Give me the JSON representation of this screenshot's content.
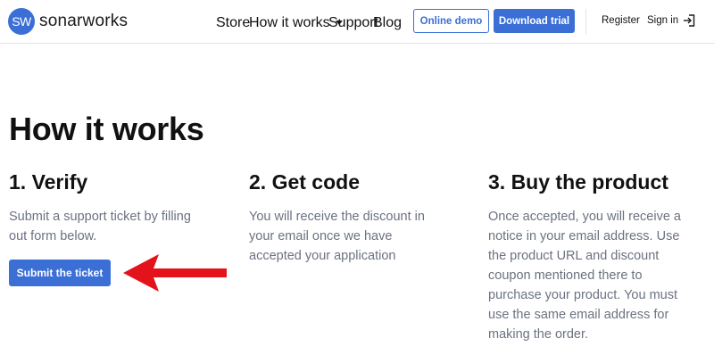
{
  "header": {
    "logo_mark": "SW",
    "logo_text": "sonarworks",
    "nav": {
      "store": "Store",
      "how_it_works": "How it works",
      "support": "Support",
      "blog": "Blog"
    },
    "online_demo": "Online demo",
    "download_trial": "Download trial",
    "register": "Register",
    "sign_in": "Sign in"
  },
  "main": {
    "title": "How it works",
    "steps": [
      {
        "title": "1. Verify",
        "text_lines": [
          "Submit a support ticket by filling",
          "out form below."
        ],
        "button": "Submit the ticket"
      },
      {
        "title": "2. Get code",
        "text_lines": [
          "You will receive the discount in",
          "your email once we have",
          "accepted your application"
        ]
      },
      {
        "title": "3. Buy the product",
        "text_lines": [
          "Once accepted, you will receive a",
          "notice in your email address. Use",
          "the product URL and discount",
          "coupon mentioned there to",
          "purchase your product. You must",
          "use the same email address for",
          "making the order."
        ]
      }
    ]
  },
  "colors": {
    "accent": "#3b6fd6",
    "arrow": "#e3121b",
    "body_text": "#6b7280"
  }
}
